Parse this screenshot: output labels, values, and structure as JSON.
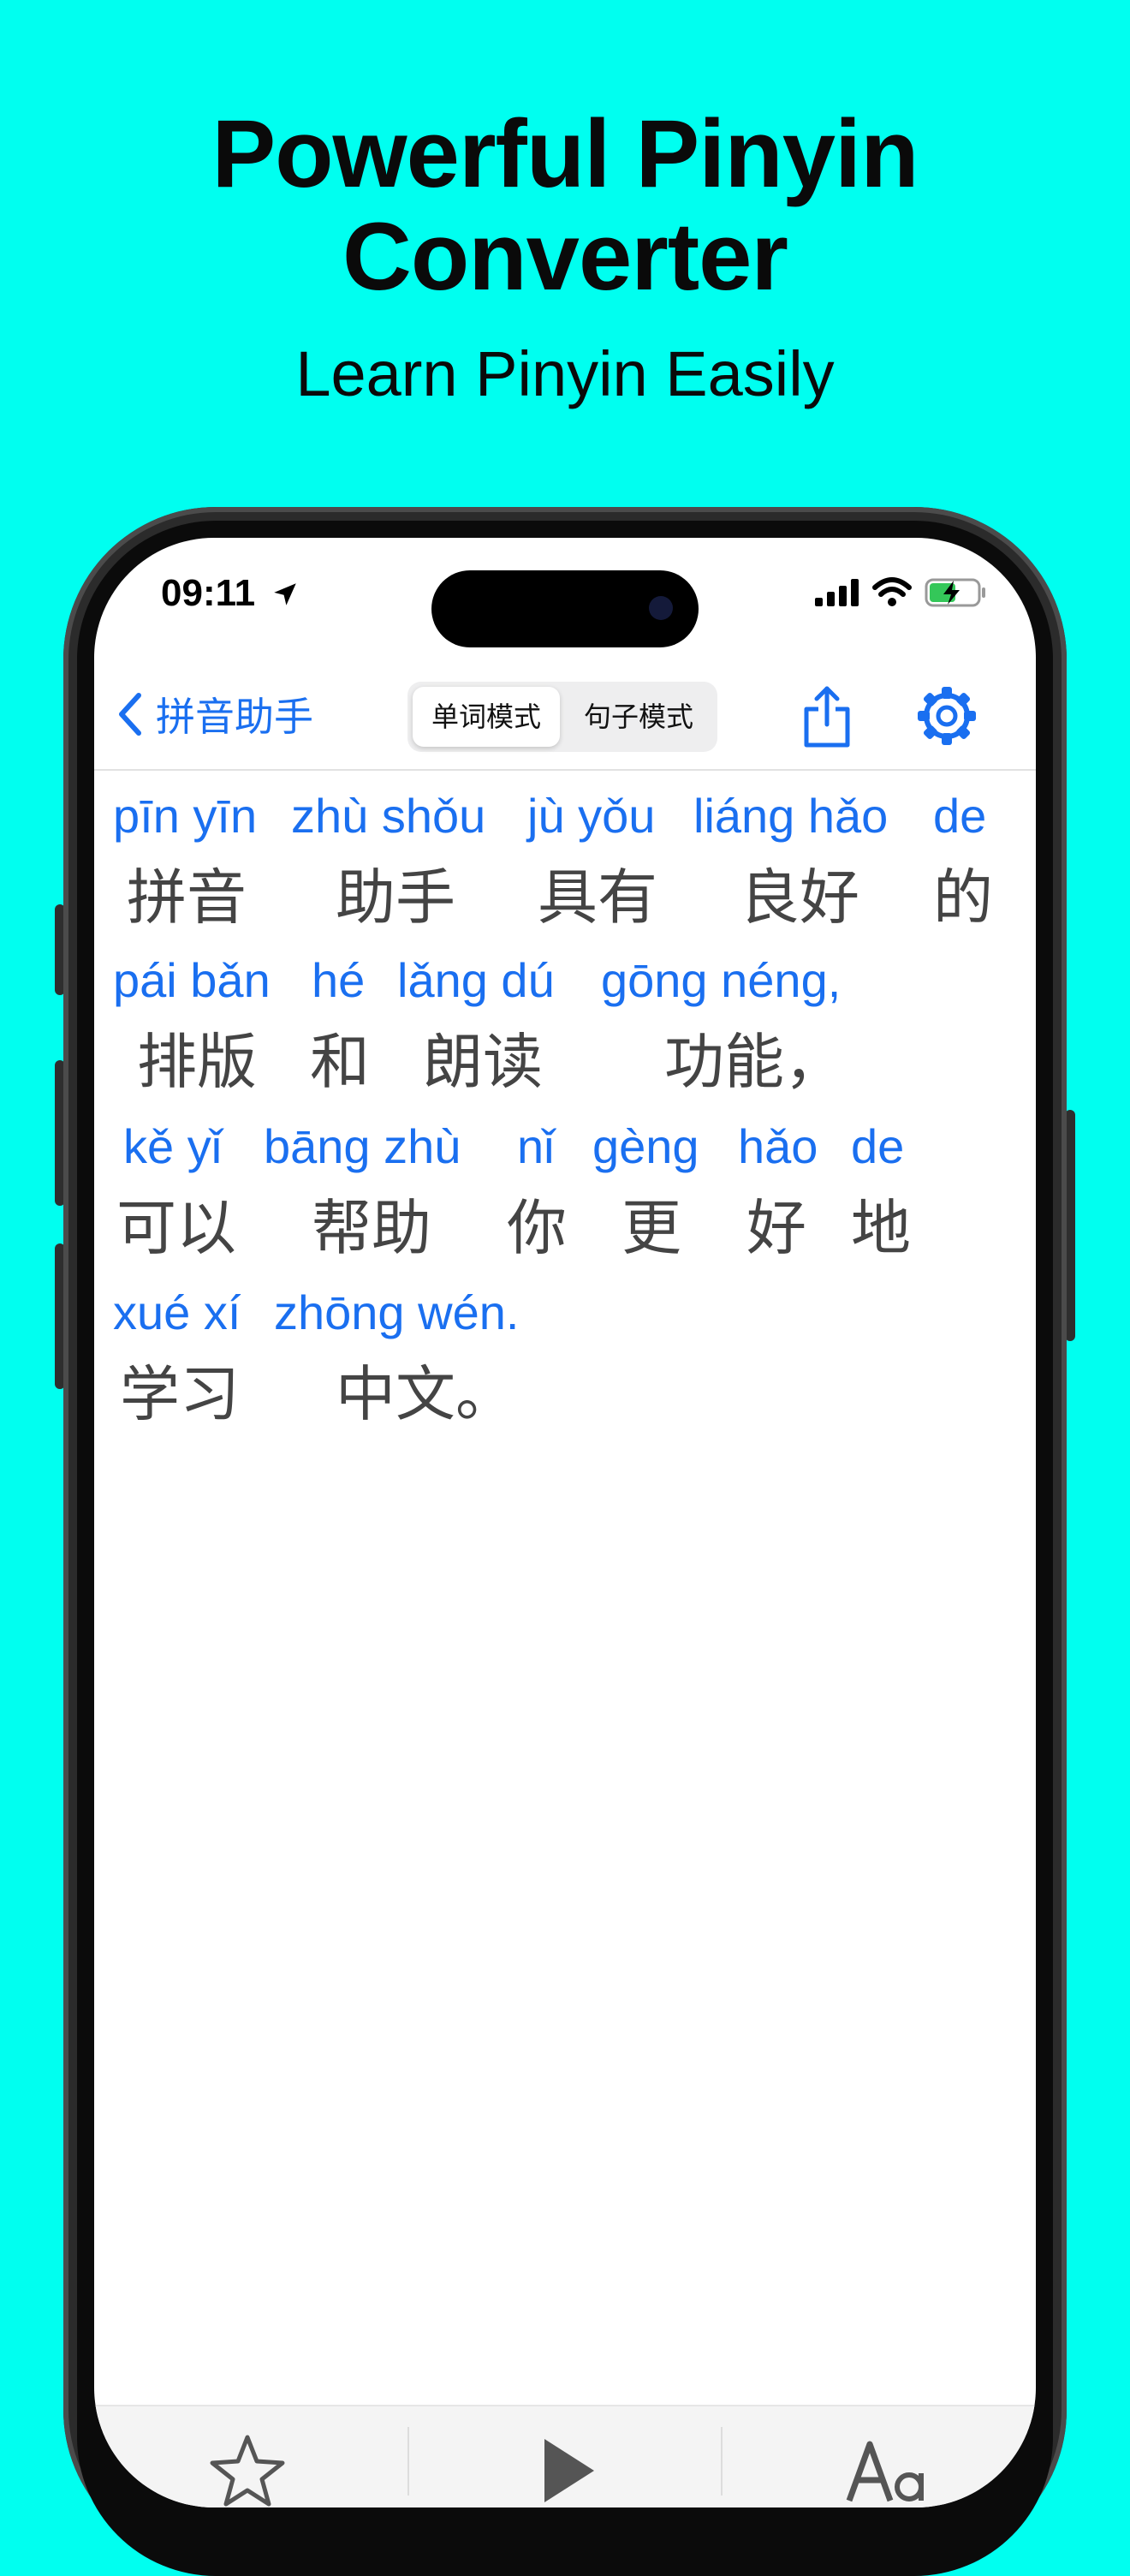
{
  "hero": {
    "title": "Powerful Pinyin Converter",
    "subtitle": "Learn Pinyin Easily"
  },
  "status_bar": {
    "time": "09:11",
    "icons": [
      "location-arrow-icon",
      "cellular-signal-icon",
      "wifi-icon",
      "battery-charging-icon"
    ]
  },
  "nav": {
    "back_label": "拼音助手",
    "segments": [
      "单词模式",
      "句子模式"
    ],
    "selected_segment": "单词模式",
    "share_icon": "share-icon",
    "settings_icon": "gear-icon"
  },
  "colors": {
    "background": "#00FFF0",
    "accent": "#1A6FF0",
    "hanzi": "#444444"
  },
  "lines": [
    {
      "words": [
        {
          "py": "pīn yīn",
          "hz": "拼音"
        },
        {
          "py": "zhù shǒu",
          "hz": "助手"
        },
        {
          "py": "jù yǒu",
          "hz": "具有"
        },
        {
          "py": "liáng hǎo",
          "hz": "良好"
        },
        {
          "py": "de",
          "hz": "的"
        }
      ]
    },
    {
      "words": [
        {
          "py": "pái bǎn",
          "hz": "排版"
        },
        {
          "py": "hé",
          "hz": "和"
        },
        {
          "py": "lǎng dú",
          "hz": "朗读"
        },
        {
          "py": "gōng néng,",
          "hz": "功能，"
        }
      ]
    },
    {
      "words": [
        {
          "py": "kě yǐ",
          "hz": "可以"
        },
        {
          "py": "bāng zhù",
          "hz": "帮助"
        },
        {
          "py": "nǐ",
          "hz": "你"
        },
        {
          "py": "gèng",
          "hz": "更"
        },
        {
          "py": "hǎo",
          "hz": "好"
        },
        {
          "py": "de",
          "hz": "地"
        }
      ]
    },
    {
      "words": [
        {
          "py": "xué xí",
          "hz": "学习"
        },
        {
          "py": "zhōng wén.",
          "hz": "中文。"
        }
      ]
    }
  ],
  "toolbar": {
    "icons": [
      "star-icon",
      "play-icon",
      "font-size-icon"
    ]
  }
}
